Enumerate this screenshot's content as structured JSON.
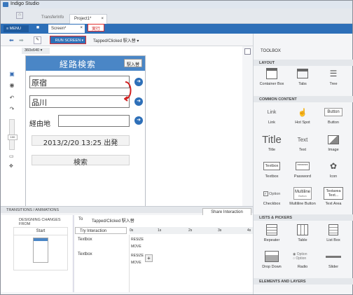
{
  "app": {
    "title": "Indigo Studio"
  },
  "tabs": {
    "transfer": "TransferInfo",
    "project": "Project1*",
    "project_close": "×"
  },
  "menubar": {
    "menu": "≡ MENU",
    "screen_tab": "Screen*",
    "screen_close": "×"
  },
  "tooltip": {
    "label": "実行"
  },
  "toolbar": {
    "run": "RUN SCREEN",
    "run_caret": "▾",
    "trigger": "Tapped/Clicked 駅入替 ▾"
  },
  "canvas": {
    "size": "360x640 ▾"
  },
  "phone": {
    "title": "経路検索",
    "swap": "駅入替",
    "from": "原宿",
    "to": "品川",
    "via_label": "経由地",
    "datetime": "2013/2/20 13:25  出発",
    "search": "検索"
  },
  "zoom": {
    "value": "100"
  },
  "toolbox": {
    "title": "TOOLBOX",
    "layout_hdr": "LAYOUT",
    "layout": [
      "Container Box",
      "Tabs",
      "Tree"
    ],
    "common_hdr": "COMMON CONTENT",
    "common": [
      "Link",
      "Hot Spot",
      "Button",
      "Title",
      "Text",
      "Image",
      "Textbox",
      "Password",
      "Icon",
      "Checkbox",
      "Multiline Button",
      "Text Area"
    ],
    "common_samples": {
      "link": "Link",
      "button": "Button",
      "title": "Title",
      "text": "Text",
      "textbox": "Textbox",
      "password": "*******",
      "option": "Option",
      "multiline": "Multiline",
      "multiline_sub": "Button",
      "textarea1": "Textarea",
      "textarea2": "Text..."
    },
    "lists_hdr": "LISTS & PICKERS",
    "lists": [
      "Repeater",
      "Table",
      "List Box",
      "Drop Down",
      "Radio",
      "Slider"
    ],
    "radio_samples": [
      "Option",
      "Option"
    ],
    "elements_hdr": "ELEMENTS AND LAYERS"
  },
  "bottom": {
    "header": "TRANSITIONS / ANIMATIONS",
    "share": "Share Interaction",
    "designing": "DESIGNING CHANGES FROM",
    "start": "Start",
    "to_label": "To",
    "to_value": "Tapped/Clicked 駅入替",
    "try": "Try Interaction",
    "ticks": [
      "0s",
      "1s",
      "2s",
      "3s",
      "4s"
    ],
    "rows": [
      {
        "name": "Textbox",
        "a": "RESIZE",
        "b": "MOVE"
      },
      {
        "name": "Textbox",
        "a": "RESIZE",
        "b": "MOVE"
      }
    ],
    "add": "+"
  },
  "colors": {
    "accent": "#2d6fb8",
    "highlight": "#e03030",
    "arrow": "#d22020"
  }
}
